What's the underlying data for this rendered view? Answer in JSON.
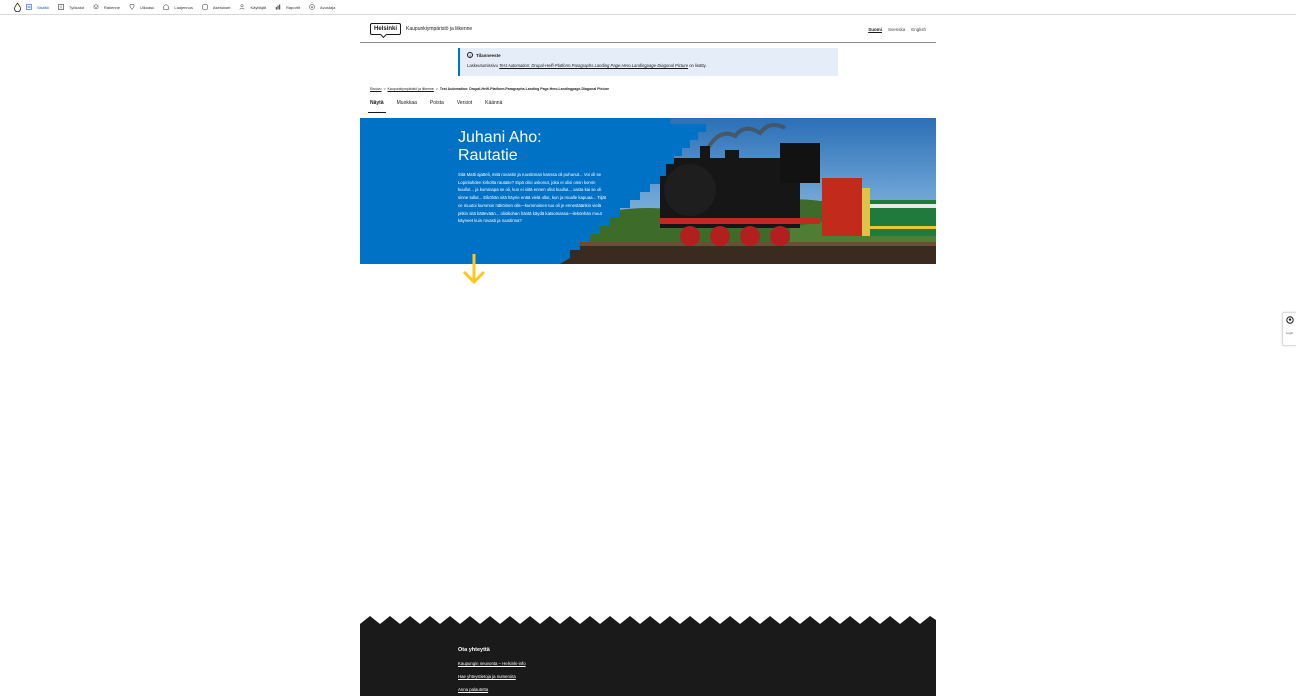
{
  "toolbar": {
    "items": [
      {
        "label": "Sisältö",
        "icon": "content-icon",
        "active": true
      },
      {
        "label": "Työkalut",
        "icon": "tools-icon"
      },
      {
        "label": "Rakenne",
        "icon": "structure-icon"
      },
      {
        "label": "Ulkoasu",
        "icon": "appearance-icon"
      },
      {
        "label": "Laajennus",
        "icon": "extend-icon"
      },
      {
        "label": "Asetukset",
        "icon": "config-icon"
      },
      {
        "label": "Käyttäjät",
        "icon": "people-icon"
      },
      {
        "label": "Raportit",
        "icon": "reports-icon"
      },
      {
        "label": "Avustaja",
        "icon": "help-icon"
      }
    ]
  },
  "header": {
    "logo": "Helsinki",
    "site_name": "Kaupunkiympäristö ja liikenne",
    "languages": [
      {
        "label": "Suomi",
        "active": true
      },
      {
        "label": "Svenska"
      },
      {
        "label": "English"
      }
    ]
  },
  "status": {
    "title": "Tilanneeste",
    "text_prefix": "Laskeutumissivu ",
    "text_link": "Test Automation: Drupal-Helfi-Platform.Paragraphs.Landing Page.Hero.Landingpage-Diagonal Picture",
    "text_suffix": " on lisätty."
  },
  "breadcrumb": {
    "home": "Etusivu",
    "parent": "Kaupunkiympäristö ja liikenne",
    "current": "Test Automation: Drupal-Helfi-Platform.Paragraphs.Landing Page.Hero.Landingpage-Diagonal Picture",
    "separator": ">"
  },
  "tabs": [
    {
      "label": "Näytä",
      "active": true
    },
    {
      "label": "Muokkaa"
    },
    {
      "label": "Poista"
    },
    {
      "label": "Versiot"
    },
    {
      "label": "Käännä"
    }
  ],
  "hero": {
    "title": "Juhani Aho: Rautatie",
    "description": "Sitä Matti ajatteli, mitä rovastin ja ruustinnan kanssa oli puhunut... Voi oli se Lopinlahden kirkolta rautatie? Eipä olisi uskonut, jokа ei olisi omin korvin kuullut... ja kummapa se oli, kun ei siitä ennen ollut kuullut... vasta kai se oli sinne tullut... Eiköhän sitä häyrie enää vielä ollut, kun ja mualle kapuaa... Tiijät ce muutoi kummon näköinen olis—kummoinen tuo oli je ennestäänkin vielä pitkin sitä kättevään... olisikohan häntä käydä katsomassa—ilekönhän muut käyneet kuin rovasti ja ruustinna?",
    "colors": {
      "background": "#0072c6",
      "arrow": "#ffc61e"
    }
  },
  "side_widget": {
    "label": "Login"
  },
  "footer": {
    "title": "Ota yhteyttä",
    "links": [
      "Kaupungin neuvonta – Helsinki-info",
      "Hae yhteystietoja ja numeroita",
      "Anna palautetta"
    ]
  }
}
